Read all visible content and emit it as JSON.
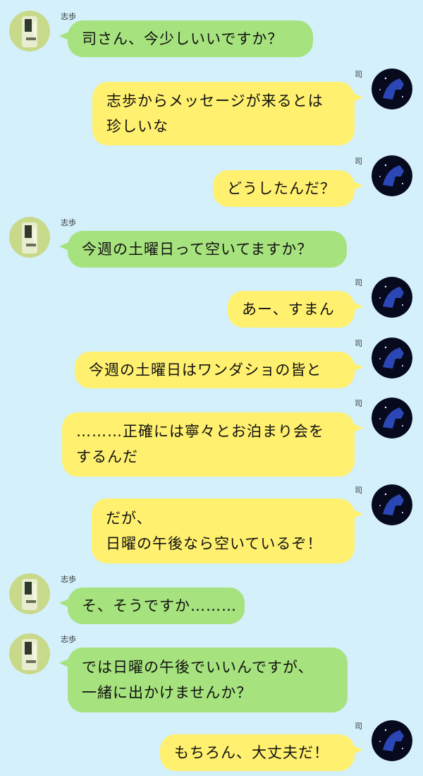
{
  "contacts": {
    "left_name": "志歩",
    "right_name": "司"
  },
  "messages": [
    {
      "side": "left",
      "name": "志歩",
      "lines": [
        "司さん、今少しいいですか？"
      ]
    },
    {
      "side": "right",
      "name": "司",
      "lines": [
        "志歩からメッセージが来るとは",
        "珍しいな"
      ]
    },
    {
      "side": "right",
      "name": "司",
      "lines": [
        "どうしたんだ？"
      ]
    },
    {
      "side": "left",
      "name": "志歩",
      "lines": [
        "今週の土曜日って空いてますか？"
      ]
    },
    {
      "side": "right",
      "name": "司",
      "lines": [
        "あー、すまん"
      ]
    },
    {
      "side": "right",
      "name": "司",
      "lines": [
        "今週の土曜日はワンダショの皆と"
      ]
    },
    {
      "side": "right",
      "name": "司",
      "lines": [
        "………正確には寧々とお泊まり会を",
        "するんだ"
      ]
    },
    {
      "side": "right",
      "name": "司",
      "lines": [
        "だが、",
        "日曜の午後なら空いているぞ！"
      ]
    },
    {
      "side": "left",
      "name": "志歩",
      "lines": [
        "そ、そうですか………"
      ]
    },
    {
      "side": "left",
      "name": "志歩",
      "lines": [
        "では日曜の午後でいいんですが、",
        "一緒に出かけませんか？"
      ]
    },
    {
      "side": "right",
      "name": "司",
      "lines": [
        "もちろん、大丈夫だ！"
      ]
    }
  ],
  "colors": {
    "background": "#d3f0fb",
    "left_bubble": "#a6e27d",
    "right_bubble": "#fff06f"
  },
  "icons": {
    "left_avatar": "guitar-avatar-icon",
    "right_avatar": "horse-constellation-avatar-icon"
  }
}
